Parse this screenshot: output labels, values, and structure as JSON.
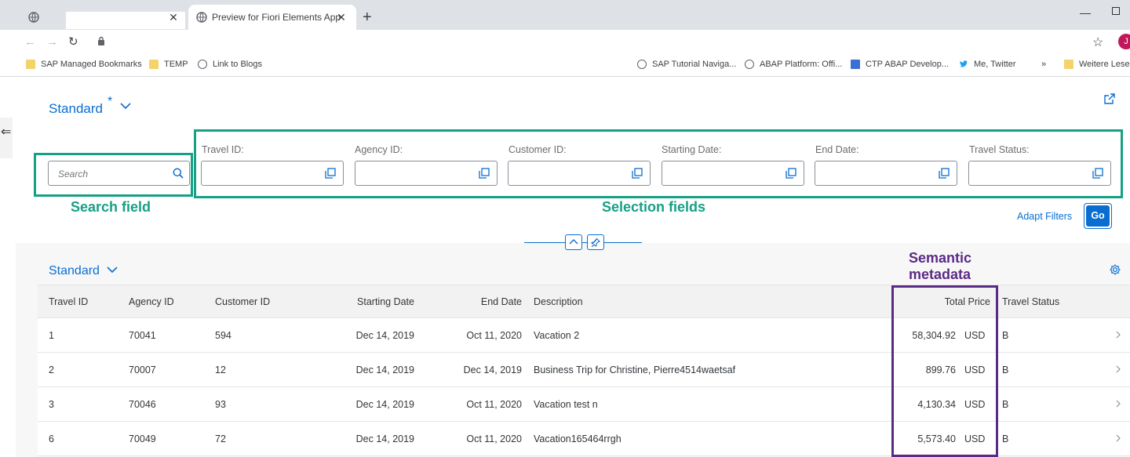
{
  "browser": {
    "tabs": [
      {
        "title": "",
        "active": false
      },
      {
        "title": "Preview for Fiori Elements App",
        "active": true
      }
    ],
    "new_tab_symbol": "+",
    "close_symbol": "✕",
    "profile_initial": "J",
    "bookmarks": [
      {
        "label": "SAP Managed Bookmarks",
        "icon": "folder-icon"
      },
      {
        "label": "TEMP",
        "icon": "folder-icon"
      },
      {
        "label": "Link to Blogs",
        "icon": "globe-icon"
      },
      {
        "label": "SAP Tutorial Naviga...",
        "icon": "globe-icon"
      },
      {
        "label": "ABAP Platform: Offi...",
        "icon": "globe-icon"
      },
      {
        "label": "CTP ABAP Develop...",
        "icon": "sap-icon"
      },
      {
        "label": "Me, Twitter",
        "icon": "twitter-icon"
      },
      {
        "label": "Weitere Lesez",
        "icon": "folder-icon"
      }
    ],
    "bookmarks_overflow": "»"
  },
  "filterbar": {
    "variant": "Standard",
    "variant_modified": "*",
    "search_placeholder": "Search",
    "fields": [
      {
        "label": "Travel ID:",
        "value": ""
      },
      {
        "label": "Agency ID:",
        "value": ""
      },
      {
        "label": "Customer ID:",
        "value": ""
      },
      {
        "label": "Starting Date:",
        "value": ""
      },
      {
        "label": "End Date:",
        "value": ""
      },
      {
        "label": "Travel Status:",
        "value": ""
      }
    ],
    "adapt_filters": "Adapt Filters",
    "go": "Go"
  },
  "annotations": {
    "search_field": "Search field",
    "selection_fields": "Selection fields",
    "semantic_line1": "Semantic",
    "semantic_line2": "metadata",
    "color_green": "#16a085",
    "color_purple": "#5b2a86"
  },
  "table": {
    "variant": "Standard",
    "columns": [
      "Travel ID",
      "Agency ID",
      "Customer ID",
      "Starting Date",
      "End Date",
      "Description",
      "Total Price",
      "Travel Status"
    ],
    "rows": [
      {
        "travel_id": "1",
        "agency_id": "70041",
        "customer_id": "594",
        "start": "Dec 14, 2019",
        "end": "Oct 11, 2020",
        "description": "Vacation 2",
        "price": "58,304.92",
        "currency": "USD",
        "status": "B"
      },
      {
        "travel_id": "2",
        "agency_id": "70007",
        "customer_id": "12",
        "start": "Dec 14, 2019",
        "end": "Dec 14, 2019",
        "description": "Business Trip for Christine, Pierre4514waetsaf",
        "price": "899.76",
        "currency": "USD",
        "status": "B"
      },
      {
        "travel_id": "3",
        "agency_id": "70046",
        "customer_id": "93",
        "start": "Dec 14, 2019",
        "end": "Oct 11, 2020",
        "description": "Vacation test n",
        "price": "4,130.34",
        "currency": "USD",
        "status": "B"
      },
      {
        "travel_id": "6",
        "agency_id": "70049",
        "customer_id": "72",
        "start": "Dec 14, 2019",
        "end": "Oct 11, 2020",
        "description": "Vacation165464rrgh",
        "price": "5,573.40",
        "currency": "USD",
        "status": "B"
      }
    ]
  },
  "colors": {
    "accent": "#0a6ed1"
  }
}
